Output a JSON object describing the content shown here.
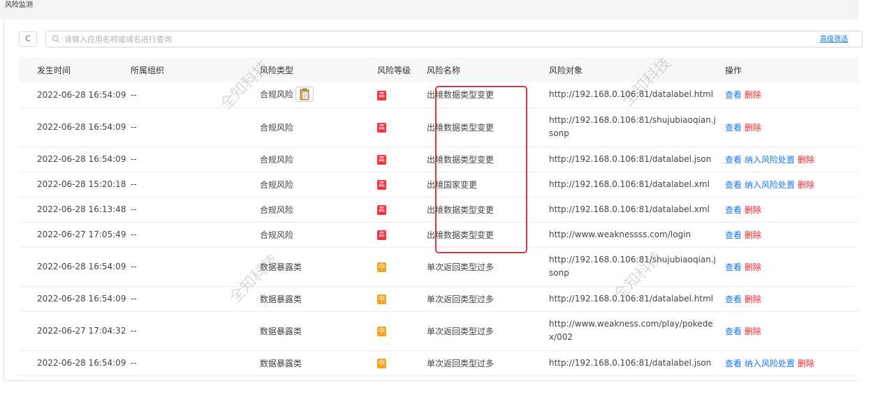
{
  "page": {
    "title": "风险监测"
  },
  "toolbar": {
    "refresh_icon": "C",
    "search_placeholder": "请输入应用名称或域名进行查询",
    "search_value": "",
    "advanced_filter": "高级筛选"
  },
  "table": {
    "headers": [
      "发生时间",
      "所属组织",
      "风险类型",
      "风险等级",
      "风险名称",
      "风险对象",
      "操作"
    ],
    "rows": [
      {
        "time": "2022-06-28 16:54:09",
        "org": "--",
        "type": "合规风险",
        "level": "高",
        "name": "出境数据类型变更",
        "object": "http://192.168.0.106:81/datalabel.html",
        "ops": [
          "查看",
          "删除"
        ]
      },
      {
        "time": "2022-06-28 16:54:09",
        "org": "--",
        "type": "合规风险",
        "level": "高",
        "name": "出境数据类型变更",
        "object": "http://192.168.0.106:81/shujubiaoqian.jsonp",
        "ops": [
          "查看",
          "删除"
        ]
      },
      {
        "time": "2022-06-28 16:54:09",
        "org": "--",
        "type": "合规风险",
        "level": "高",
        "name": "出境数据类型变更",
        "object": "http://192.168.0.106:81/datalabel.json",
        "ops": [
          "查看",
          "纳入风险处置",
          "删除"
        ]
      },
      {
        "time": "2022-06-28 15:20:18",
        "org": "--",
        "type": "合规风险",
        "level": "高",
        "name": "出境国家变更",
        "object": "http://192.168.0.106:81/datalabel.xml",
        "ops": [
          "查看",
          "纳入风险处置",
          "删除"
        ]
      },
      {
        "time": "2022-06-28 16:13:48",
        "org": "--",
        "type": "合规风险",
        "level": "高",
        "name": "出境数据类型变更",
        "object": "http://192.168.0.106:81/datalabel.xml",
        "ops": [
          "查看",
          "删除"
        ]
      },
      {
        "time": "2022-06-27 17:05:49",
        "org": "--",
        "type": "合规风险",
        "level": "高",
        "name": "出境数据类型变更",
        "object": "http://www.weaknessss.com/login",
        "ops": [
          "查看",
          "删除"
        ]
      },
      {
        "time": "2022-06-28 16:54:09",
        "org": "--",
        "type": "数据暴露类",
        "level": "中",
        "name": "单次返回类型过多",
        "object": "http://192.168.0.106:81/shujubiaoqian.jsonp",
        "ops": [
          "查看",
          "删除"
        ]
      },
      {
        "time": "2022-06-28 16:54:09",
        "org": "--",
        "type": "数据暴露类",
        "level": "中",
        "name": "单次返回类型过多",
        "object": "http://192.168.0.106:81/datalabel.html",
        "ops": [
          "查看",
          "删除"
        ]
      },
      {
        "time": "2022-06-27 17:04:32",
        "org": "--",
        "type": "数据暴露类",
        "level": "中",
        "name": "单次返回类型过多",
        "object": "http://www.weakness.com/play/pokedex/002",
        "ops": [
          "查看",
          "删除"
        ]
      },
      {
        "time": "2022-06-28 16:54:09",
        "org": "--",
        "type": "数据暴露类",
        "level": "中",
        "name": "单次返回类型过多",
        "object": "http://192.168.0.106:81/datalabel.json",
        "ops": [
          "查看",
          "纳入风险处置",
          "删除"
        ]
      }
    ]
  },
  "level_colors": {
    "高": "#f5333f",
    "中": "#f7a521"
  },
  "watermark": "全知科技",
  "icons": {
    "search": "search-icon",
    "refresh": "refresh-icon",
    "clipboard": "clipboard-icon"
  }
}
